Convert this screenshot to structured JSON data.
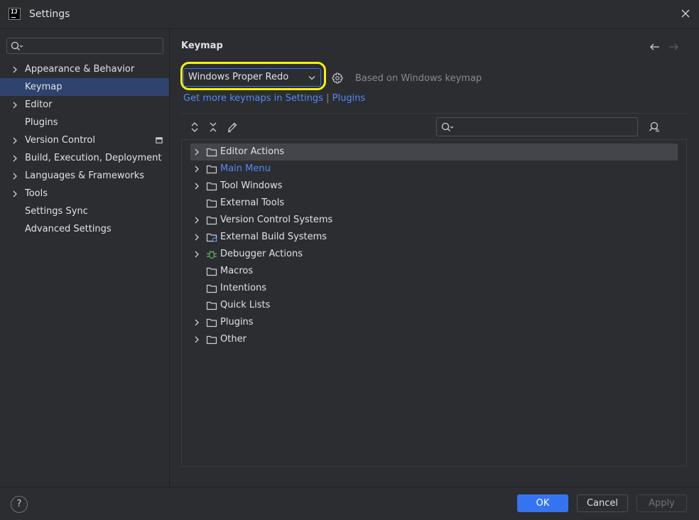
{
  "window": {
    "title": "Settings",
    "app_logo_text": "IJ"
  },
  "sidebar": {
    "search_placeholder": "",
    "items": [
      {
        "label": "Appearance & Behavior",
        "expandable": true
      },
      {
        "label": "Keymap",
        "expandable": false,
        "selected": true
      },
      {
        "label": "Editor",
        "expandable": true
      },
      {
        "label": "Plugins",
        "expandable": false
      },
      {
        "label": "Version Control",
        "expandable": true
      },
      {
        "label": "Build, Execution, Deployment",
        "expandable": true
      },
      {
        "label": "Languages & Frameworks",
        "expandable": true
      },
      {
        "label": "Tools",
        "expandable": true
      },
      {
        "label": "Settings Sync",
        "expandable": false
      },
      {
        "label": "Advanced Settings",
        "expandable": false
      }
    ]
  },
  "keymap": {
    "title": "Keymap",
    "selected_keymap": "Windows Proper Redo",
    "based_on": "Based on Windows keymap",
    "more_link": "Get more keymaps in Settings",
    "separator": "|",
    "plugins_link": "Plugins",
    "tree_search_placeholder": "",
    "tree": [
      {
        "label": "Editor Actions",
        "expandable": true,
        "icon": "folder-icon",
        "selected": true
      },
      {
        "label": "Main Menu",
        "expandable": true,
        "icon": "folder-icon",
        "link": true
      },
      {
        "label": "Tool Windows",
        "expandable": true,
        "icon": "folder-icon"
      },
      {
        "label": "External Tools",
        "expandable": false,
        "icon": "folder-icon"
      },
      {
        "label": "Version Control Systems",
        "expandable": true,
        "icon": "folder-icon"
      },
      {
        "label": "External Build Systems",
        "expandable": true,
        "icon": "folder-gear-icon"
      },
      {
        "label": "Debugger Actions",
        "expandable": true,
        "icon": "bug-icon"
      },
      {
        "label": "Macros",
        "expandable": false,
        "icon": "folder-icon"
      },
      {
        "label": "Intentions",
        "expandable": false,
        "icon": "folder-icon"
      },
      {
        "label": "Quick Lists",
        "expandable": false,
        "icon": "folder-icon"
      },
      {
        "label": "Plugins",
        "expandable": true,
        "icon": "folder-icon"
      },
      {
        "label": "Other",
        "expandable": true,
        "icon": "folder-icon"
      }
    ]
  },
  "footer": {
    "help_label": "?",
    "ok_label": "OK",
    "cancel_label": "Cancel",
    "apply_label": "Apply"
  },
  "colors": {
    "background": "#2b2d30",
    "accent": "#3574f0",
    "link": "#548af7",
    "selection": "#2e436e",
    "highlight": "#f5f20a"
  }
}
